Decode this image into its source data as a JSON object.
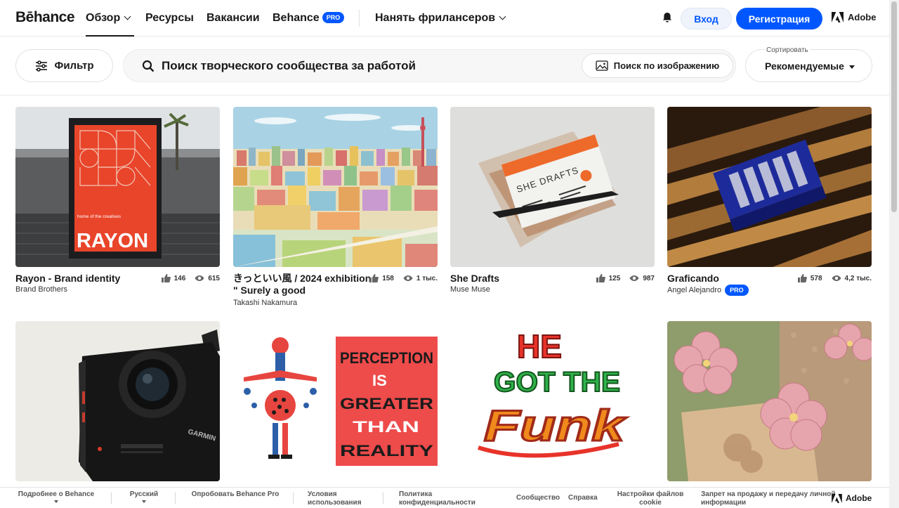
{
  "nav": {
    "logo": "Bēhance",
    "items": [
      "Обзор",
      "Ресурсы",
      "Вакансии",
      "Behance"
    ],
    "pro_badge": "PRO",
    "hire": "Нанять фрилансеров",
    "login": "Вход",
    "signup": "Регистрация",
    "adobe": "Adobe"
  },
  "filterbar": {
    "filter_label": "Фильтр",
    "search_placeholder": "Поиск творческого сообщества за работой",
    "image_search_label": "Поиск по изображению",
    "sort_label": "Сортировать",
    "sort_value": "Рекомендуемые"
  },
  "projects": [
    {
      "title": "Rayon - Brand identity",
      "owner": "Brand Brothers",
      "likes": "146",
      "views": "615",
      "owner_pro": false
    },
    {
      "title": "きっといい風 / 2024 exhibition \" Surely a good",
      "owner": "Takashi Nakamura",
      "likes": "158",
      "views": "1 тыс.",
      "owner_pro": false
    },
    {
      "title": "She Drafts",
      "owner": "Muse Muse",
      "likes": "125",
      "views": "987",
      "owner_pro": false
    },
    {
      "title": "Graficando",
      "owner": "Angel Alejandro",
      "likes": "578",
      "views": "4,2 тыс.",
      "owner_pro": true,
      "pro_label": "PRO"
    }
  ],
  "artwork": {
    "rayon_poster_small": "home of the creatives",
    "rayon_poster_word": "RAYON",
    "she_drafts_card": "SHE DRAFTS",
    "perception_poster": "PERCEPTION IS GREATER THAN REALITY",
    "funk_lettering": "HE GOT THE FUNK",
    "camera_brand": "GARMIN"
  },
  "colors": {
    "accent": "#0057ff",
    "rayon_orange": "#e8452a"
  },
  "footer": {
    "items": [
      "Подробнее о Behance",
      "Русский",
      "Опробовать Behance Pro",
      "Условия использования",
      "Политика конфиденциальности",
      "Сообщество",
      "Справка",
      "Настройки файлов cookie",
      "Запрет на продажу и передачу личной информации"
    ],
    "adobe": "Adobe"
  }
}
